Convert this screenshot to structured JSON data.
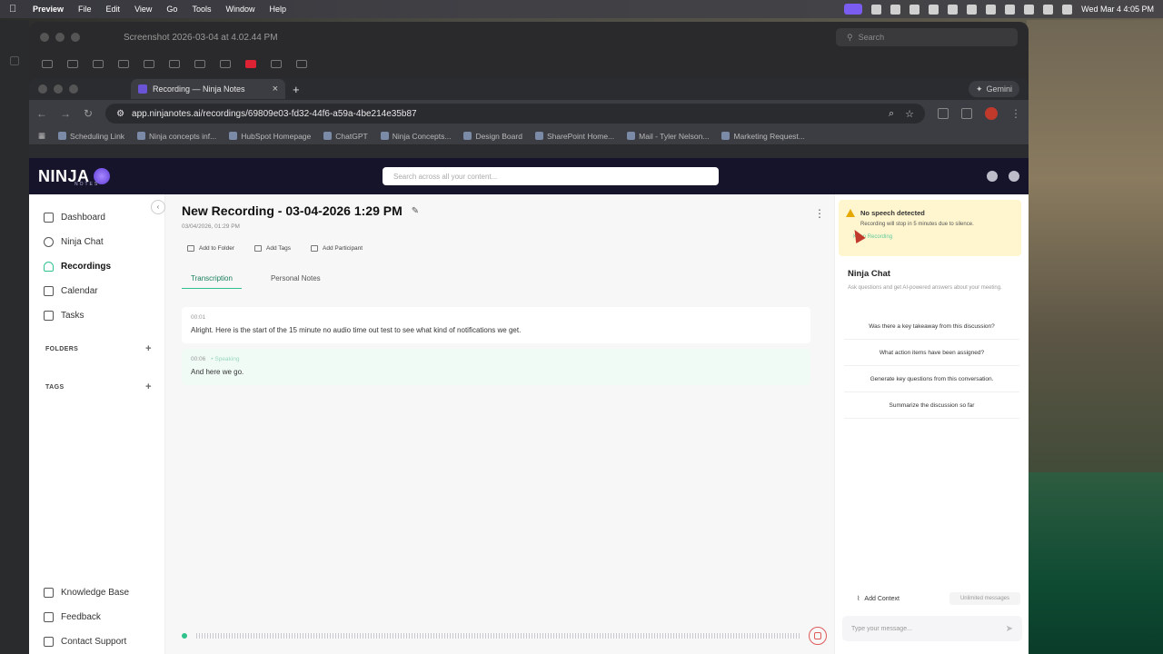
{
  "menubar": {
    "app": "Preview",
    "items": [
      "File",
      "Edit",
      "View",
      "Go",
      "Tools",
      "Window",
      "Help"
    ],
    "clock": "Wed Mar 4  4:05 PM"
  },
  "preview": {
    "title": "Screenshot 2026-03-04 at 4.02.44 PM",
    "search_placeholder": "Search"
  },
  "browser": {
    "tab_title": "Recording — Ninja Notes",
    "gemini_label": "Gemini",
    "url": "app.ninjanotes.ai/recordings/69809e03-fd32-44f6-a59a-4be214e35b87",
    "bookmarks": [
      "Scheduling Link",
      "Ninja concepts inf...",
      "HubSpot Homepage",
      "ChatGPT",
      "Ninja Concepts...",
      "Design Board",
      "SharePoint Home...",
      "Mail - Tyler Nelson...",
      "Marketing Request..."
    ]
  },
  "app": {
    "logo": "NINJA",
    "logo_sub": "NOTES",
    "search_placeholder": "Search across all your content...",
    "sidebar": {
      "items": [
        {
          "label": "Dashboard"
        },
        {
          "label": "Ninja Chat"
        },
        {
          "label": "Recordings"
        },
        {
          "label": "Calendar"
        },
        {
          "label": "Tasks"
        }
      ],
      "folders_label": "FOLDERS",
      "tags_label": "TAGS",
      "bottom": [
        {
          "label": "Knowledge Base"
        },
        {
          "label": "Feedback"
        },
        {
          "label": "Contact Support"
        }
      ]
    },
    "recording": {
      "title": "New Recording - 03-04-2026 1:29 PM",
      "date": "03/04/2026, 01:29 PM",
      "actions": [
        "Add to Folder",
        "Add Tags",
        "Add Participant"
      ],
      "tabs": [
        "Transcription",
        "Personal Notes"
      ],
      "segments": [
        {
          "time": "00:01",
          "speaker": "",
          "text": "Alright. Here is the start of the 15 minute no audio time out test to see what kind of notifications we get."
        },
        {
          "time": "00:06",
          "speaker": "• Speaking",
          "text": "And here we go."
        }
      ]
    },
    "alert": {
      "title": "No speech detected",
      "body": "Recording will stop in 5 minutes due to silence.",
      "action": "Keep Recording"
    },
    "chat": {
      "title": "Ninja Chat",
      "subtitle": "Ask questions and get AI-powered answers about your meeting.",
      "suggestions": [
        "Was there a key takeaway from this discussion?",
        "What action items have been assigned?",
        "Generate key questions from this conversation.",
        "Summarize the discussion so far"
      ],
      "add_context": "Add Context",
      "unlimited": "Unlimited messages",
      "input_placeholder": "Type your message..."
    }
  }
}
